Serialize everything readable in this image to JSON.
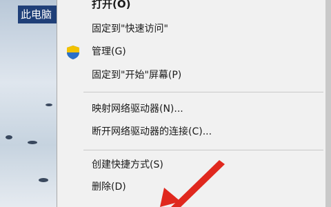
{
  "desktop": {
    "icon_label": "此电脑"
  },
  "context_menu": {
    "items": [
      {
        "label": "打开(O)"
      },
      {
        "label": "固定到\"快速访问\""
      },
      {
        "label": "管理(G)",
        "icon": "shield-icon"
      },
      {
        "label": "固定到\"开始\"屏幕(P)"
      },
      {
        "label": "映射网络驱动器(N)..."
      },
      {
        "label": "断开网络驱动器的连接(C)..."
      },
      {
        "label": "创建快捷方式(S)"
      },
      {
        "label": "删除(D)"
      }
    ]
  },
  "colors": {
    "menu_bg": "#f1f1f1",
    "arrow": "#e0281e",
    "selection": "#1f3f78"
  }
}
